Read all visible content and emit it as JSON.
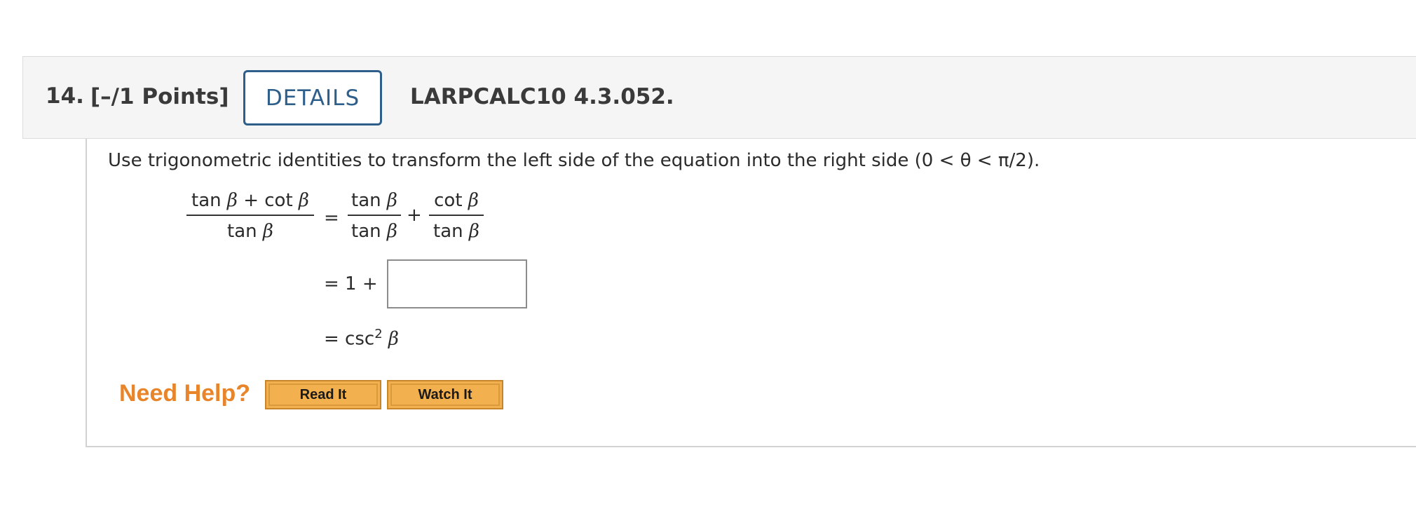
{
  "header": {
    "number": "14.",
    "points": "[–/1 Points]",
    "details_label": "DETAILS",
    "code": "LARPCALC10 4.3.052."
  },
  "question": {
    "prompt_text": "Use trigonometric identities to transform the left side of the equation into the right side (0 < θ < π/2).",
    "lhs": {
      "numerator": "tan β + cot β",
      "denominator": "tan β"
    },
    "step1": {
      "equals": "=",
      "frac1": {
        "numerator": "tan β",
        "denominator": "tan β"
      },
      "plus": "+",
      "frac2": {
        "numerator": "cot β",
        "denominator": "tan β"
      }
    },
    "step2": {
      "prefix": "= 1 +",
      "answer_value": ""
    },
    "step3": {
      "prefix": "= csc",
      "exponent": "2",
      "variable": "β"
    }
  },
  "help": {
    "label": "Need Help?",
    "read_it": "Read It",
    "watch_it": "Watch It"
  },
  "colors": {
    "details_border": "#2e5f8a",
    "need_help": "#e8852a",
    "help_button": "#f3b04e"
  }
}
